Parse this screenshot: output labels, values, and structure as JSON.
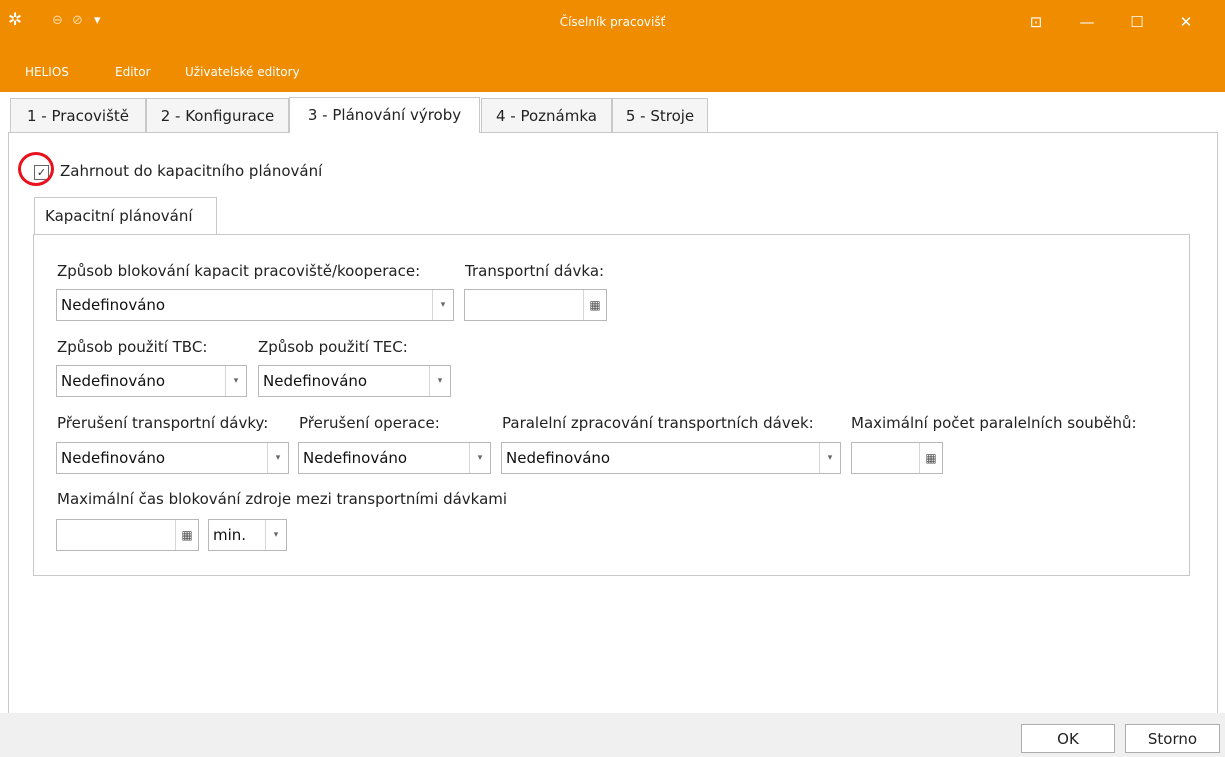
{
  "window": {
    "title": "Číselník pracovišť",
    "app_icon": "✲",
    "undo_icon": "⊖",
    "redo_icon": "⊘",
    "qa_dropdown_icon": "▾",
    "pin_icon": "⊡",
    "minimize_icon": "—",
    "maximize_icon": "☐",
    "close_icon": "✕"
  },
  "menu": [
    "HELIOS",
    "Editor",
    "Uživatelské editory"
  ],
  "tabs": [
    "1 - Pracoviště",
    "2 - Konfigurace",
    "3 - Plánování výroby",
    "4 - Poznámka",
    "5 - Stroje"
  ],
  "active_tab": "3 - Plánování výroby",
  "checkbox": {
    "label": "Zahrnout do kapacitního plánování",
    "checked": true,
    "mark": "✓"
  },
  "inner_tab": "Kapacitní plánování",
  "fields": {
    "blokovani": {
      "label": "Způsob blokování kapacit pracoviště/kooperace:",
      "value": "Nedefinováno"
    },
    "transport_davka": {
      "label": "Transportní dávka:",
      "value": ""
    },
    "tbc": {
      "label": "Způsob použití TBC:",
      "value": "Nedefinováno"
    },
    "tec": {
      "label": "Způsob použití TEC:",
      "value": "Nedefinováno"
    },
    "preruseni_davky": {
      "label": "Přerušení transportní dávky:",
      "value": "Nedefinováno"
    },
    "preruseni_operace": {
      "label": "Přerušení operace:",
      "value": "Nedefinováno"
    },
    "paralelni": {
      "label": "Paralelní zpracování transportních dávek:",
      "value": "Nedefinováno"
    },
    "max_soubehu": {
      "label": "Maximální počet paralelních souběhů:",
      "value": ""
    },
    "max_cas": {
      "label": "Maximální čas blokování zdroje mezi transportními dávkami",
      "value": "",
      "unit": "min."
    }
  },
  "icons": {
    "dropdown": "▾",
    "calculator": "▦"
  },
  "buttons": {
    "ok": "OK",
    "cancel": "Storno"
  },
  "colors": {
    "accent": "#f08c00",
    "highlight_circle": "#e8121c"
  }
}
